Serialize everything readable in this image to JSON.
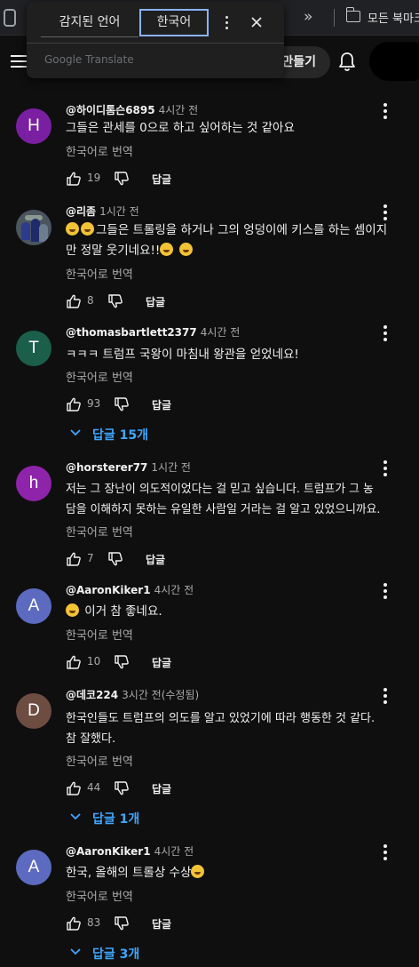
{
  "browser": {
    "more_chevrons": "»",
    "bookmark_folder_label": "모든 북마크"
  },
  "header": {
    "create_label": "만들기"
  },
  "translate_popup": {
    "tab_detected": "감지된 언어",
    "tab_korean": "한국어",
    "brand": "Google Translate"
  },
  "comments": [
    {
      "avatar_letter": "H",
      "avatar_color": "#7b1fa2",
      "author": "@하이디톰슨6895",
      "time": "4시간 전",
      "lines": [
        "그들은 관세를 0으로 하고 싶어하는 것 같아요"
      ],
      "translate_label": "한국어로 번역",
      "likes": "19",
      "reply_label": "답글"
    },
    {
      "avatar_letter": "",
      "avatar_color": "#4a5560",
      "author": "@리좀",
      "time": "1시간 전",
      "lines": [
        "그들은 트롤링을 하거나 그의 엉덩이에 키스를 하는 셈이지",
        "만 정말 웃기네요!!"
      ],
      "translate_label": "한국어로 번역",
      "likes": "8",
      "reply_label": "답글"
    },
    {
      "avatar_letter": "T",
      "avatar_color": "#1b5e4a",
      "author": "@thomasbartlett2377",
      "time": "4시간 전",
      "lines": [
        "ㅋㅋㅋ 트럼프 국왕이 마침내 왕관을 얻었네요!"
      ],
      "translate_label": "한국어로 번역",
      "likes": "93",
      "reply_label": "답글",
      "replies_label": "답글 15개"
    },
    {
      "avatar_letter": "h",
      "avatar_color": "#8e24aa",
      "author": "@horsterer77",
      "time": "1시간 전",
      "lines": [
        "저는 그 장난이 의도적이었다는 걸 믿고 싶습니다. 트럼프가 그 농",
        "담을 이해하지 못하는 유일한 사람일 거라는 걸 알고 있었으니까요."
      ],
      "translate_label": "한국어로 번역",
      "likes": "7",
      "reply_label": "답글"
    },
    {
      "avatar_letter": "A",
      "avatar_color": "#5c6bc0",
      "author": "@AaronKiker1",
      "time": "4시간 전",
      "lines": [
        "이거 참 좋네요."
      ],
      "translate_label": "한국어로 번역",
      "likes": "10",
      "reply_label": "답글"
    },
    {
      "avatar_letter": "D",
      "avatar_color": "#6d4c41",
      "author": "@데코224",
      "time": "3시간 전(수정됨)",
      "lines": [
        "한국인들도 트럼프의 의도를 알고 있었기에 따라 행동한 것 같다.",
        "참 잘했다."
      ],
      "translate_label": "한국어로 번역",
      "likes": "44",
      "reply_label": "답글",
      "replies_label": "답글 1개"
    },
    {
      "avatar_letter": "A",
      "avatar_color": "#5c6bc0",
      "author": "@AaronKiker1",
      "time": "4시간 전",
      "lines": [
        "한국, 올해의 트롤상 수상"
      ],
      "translate_label": "한국어로 번역",
      "likes": "83",
      "reply_label": "답글",
      "replies_label": "답글 3개"
    }
  ]
}
